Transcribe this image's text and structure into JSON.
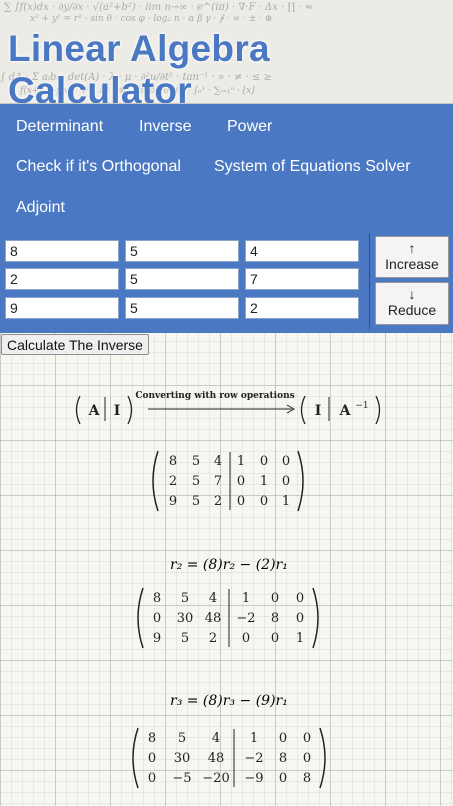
{
  "header": {
    "title": "Linear Algebra Calculator"
  },
  "nav": {
    "items": [
      {
        "label": "Determinant"
      },
      {
        "label": "Inverse"
      },
      {
        "label": "Power"
      },
      {
        "label": "Check if it's Orthogonal"
      },
      {
        "label": "System of Equations Solver"
      },
      {
        "label": "Adjoint"
      }
    ]
  },
  "matrix_input": {
    "rows": [
      [
        "8",
        "5",
        "4"
      ],
      [
        "2",
        "5",
        "7"
      ],
      [
        "9",
        "5",
        "2"
      ]
    ],
    "increase_label": "Increase",
    "reduce_label": "Reduce",
    "increase_arrow": "↑",
    "reduce_arrow": "↓"
  },
  "calculate_label": "Calculate The Inverse",
  "result": {
    "intro": {
      "left": "A",
      "left_identity": "I",
      "arrow_caption": "Converting with row operations",
      "right_identity": "I",
      "right": "A",
      "right_sup": "−1"
    },
    "steps": [
      {
        "operation": "",
        "left": [
          [
            "8",
            "5",
            "4"
          ],
          [
            "2",
            "5",
            "7"
          ],
          [
            "9",
            "5",
            "2"
          ]
        ],
        "right": [
          [
            "1",
            "0",
            "0"
          ],
          [
            "0",
            "1",
            "0"
          ],
          [
            "0",
            "0",
            "1"
          ]
        ]
      },
      {
        "operation": "r₂ = (8)r₂ − (2)r₁",
        "left": [
          [
            "8",
            "5",
            "4"
          ],
          [
            "0",
            "30",
            "48"
          ],
          [
            "9",
            "5",
            "2"
          ]
        ],
        "right": [
          [
            "1",
            "0",
            "0"
          ],
          [
            "−2",
            "8",
            "0"
          ],
          [
            "0",
            "0",
            "1"
          ]
        ]
      },
      {
        "operation": "r₃ = (8)r₃ − (9)r₁",
        "left": [
          [
            "8",
            "5",
            "4"
          ],
          [
            "0",
            "30",
            "48"
          ],
          [
            "0",
            "−5",
            "−20"
          ]
        ],
        "right": [
          [
            "1",
            "0",
            "0"
          ],
          [
            "−2",
            "8",
            "0"
          ],
          [
            "−9",
            "0",
            "8"
          ]
        ]
      }
    ]
  }
}
